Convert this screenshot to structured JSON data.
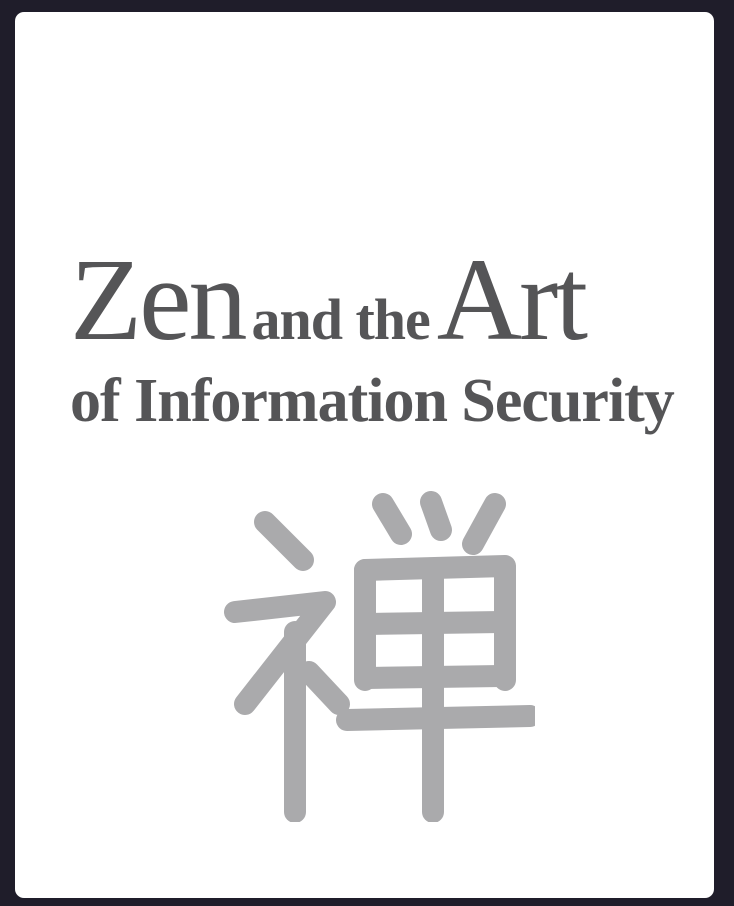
{
  "cover": {
    "title_word_1": "Zen",
    "title_word_2": "and the",
    "title_word_3": "Art",
    "subtitle": "of Information Security",
    "kanji": "禅",
    "kanji_color": "#aaaaac",
    "title_color": "#555557",
    "background_color": "#ffffff",
    "frame_color": "#1f1d2a"
  }
}
